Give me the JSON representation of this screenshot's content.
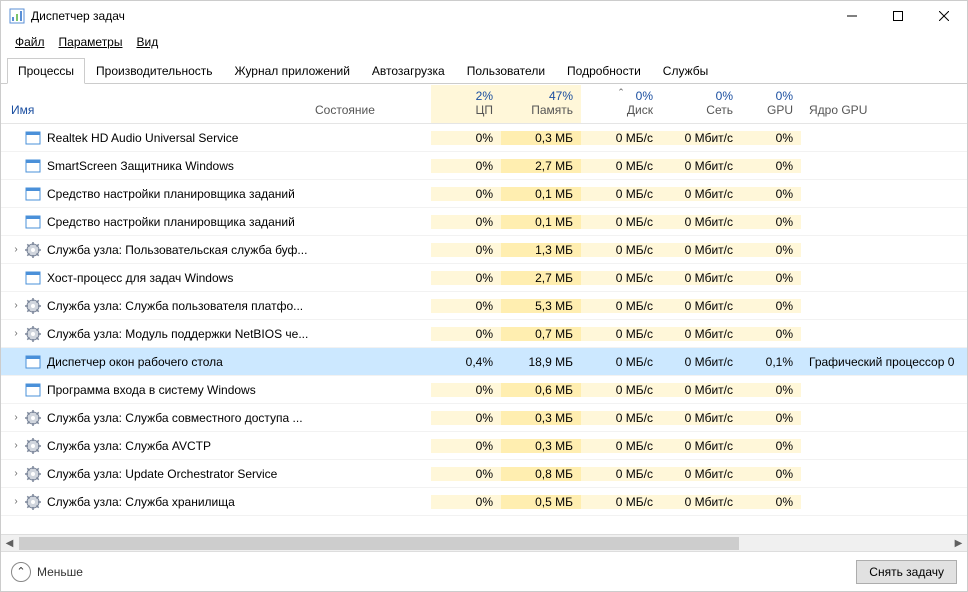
{
  "window": {
    "title": "Диспетчер задач"
  },
  "menu": {
    "file": "Файл",
    "options": "Параметры",
    "view": "Вид"
  },
  "tabs": [
    {
      "label": "Процессы",
      "active": true
    },
    {
      "label": "Производительность"
    },
    {
      "label": "Журнал приложений"
    },
    {
      "label": "Автозагрузка"
    },
    {
      "label": "Пользователи"
    },
    {
      "label": "Подробности"
    },
    {
      "label": "Службы"
    }
  ],
  "columns": {
    "name": "Имя",
    "state": "Состояние",
    "cpu_top": "2%",
    "cpu_bot": "ЦП",
    "mem_top": "47%",
    "mem_bot": "Память",
    "disk_top": "0%",
    "disk_bot": "Диск",
    "net_top": "0%",
    "net_bot": "Сеть",
    "gpu_top": "0%",
    "gpu_bot": "GPU",
    "gpucore": "Ядро GPU"
  },
  "processes": [
    {
      "icon": "app",
      "name": "Realtek HD Audio Universal Service",
      "cpu": "0%",
      "mem": "0,3 МБ",
      "disk": "0 МБ/с",
      "net": "0 Мбит/с",
      "gpu": "0%",
      "gpucore": ""
    },
    {
      "icon": "app",
      "name": "SmartScreen Защитника Windows",
      "cpu": "0%",
      "mem": "2,7 МБ",
      "disk": "0 МБ/с",
      "net": "0 Мбит/с",
      "gpu": "0%",
      "gpucore": ""
    },
    {
      "icon": "app",
      "name": "Средство настройки планировщика заданий",
      "cpu": "0%",
      "mem": "0,1 МБ",
      "disk": "0 МБ/с",
      "net": "0 Мбит/с",
      "gpu": "0%",
      "gpucore": ""
    },
    {
      "icon": "app",
      "name": "Средство настройки планировщика заданий",
      "cpu": "0%",
      "mem": "0,1 МБ",
      "disk": "0 МБ/с",
      "net": "0 Мбит/с",
      "gpu": "0%",
      "gpucore": ""
    },
    {
      "icon": "gear",
      "expandable": true,
      "name": "Служба узла: Пользовательская служба буф...",
      "cpu": "0%",
      "mem": "1,3 МБ",
      "disk": "0 МБ/с",
      "net": "0 Мбит/с",
      "gpu": "0%",
      "gpucore": ""
    },
    {
      "icon": "app",
      "name": "Хост-процесс для задач Windows",
      "cpu": "0%",
      "mem": "2,7 МБ",
      "disk": "0 МБ/с",
      "net": "0 Мбит/с",
      "gpu": "0%",
      "gpucore": ""
    },
    {
      "icon": "gear",
      "expandable": true,
      "name": "Служба узла: Служба пользователя платфо...",
      "cpu": "0%",
      "mem": "5,3 МБ",
      "disk": "0 МБ/с",
      "net": "0 Мбит/с",
      "gpu": "0%",
      "gpucore": ""
    },
    {
      "icon": "gear",
      "expandable": true,
      "name": "Служба узла: Модуль поддержки NetBIOS че...",
      "cpu": "0%",
      "mem": "0,7 МБ",
      "disk": "0 МБ/с",
      "net": "0 Мбит/с",
      "gpu": "0%",
      "gpucore": ""
    },
    {
      "icon": "app",
      "selected": true,
      "name": "Диспетчер окон рабочего стола",
      "cpu": "0,4%",
      "mem": "18,9 МБ",
      "disk": "0 МБ/с",
      "net": "0 Мбит/с",
      "gpu": "0,1%",
      "gpucore": "Графический процессор 0"
    },
    {
      "icon": "app",
      "name": "Программа входа в систему Windows",
      "cpu": "0%",
      "mem": "0,6 МБ",
      "disk": "0 МБ/с",
      "net": "0 Мбит/с",
      "gpu": "0%",
      "gpucore": ""
    },
    {
      "icon": "gear",
      "expandable": true,
      "name": "Служба узла: Служба совместного доступа ...",
      "cpu": "0%",
      "mem": "0,3 МБ",
      "disk": "0 МБ/с",
      "net": "0 Мбит/с",
      "gpu": "0%",
      "gpucore": ""
    },
    {
      "icon": "gear",
      "expandable": true,
      "name": "Служба узла: Служба AVCTP",
      "cpu": "0%",
      "mem": "0,3 МБ",
      "disk": "0 МБ/с",
      "net": "0 Мбит/с",
      "gpu": "0%",
      "gpucore": ""
    },
    {
      "icon": "gear",
      "expandable": true,
      "name": "Служба узла: Update Orchestrator Service",
      "cpu": "0%",
      "mem": "0,8 МБ",
      "disk": "0 МБ/с",
      "net": "0 Мбит/с",
      "gpu": "0%",
      "gpucore": ""
    },
    {
      "icon": "gear",
      "expandable": true,
      "name": "Служба узла: Служба хранилища",
      "cpu": "0%",
      "mem": "0,5 МБ",
      "disk": "0 МБ/с",
      "net": "0 Мбит/с",
      "gpu": "0%",
      "gpucore": ""
    }
  ],
  "footer": {
    "fewer": "Меньше",
    "end_task": "Снять задачу"
  }
}
